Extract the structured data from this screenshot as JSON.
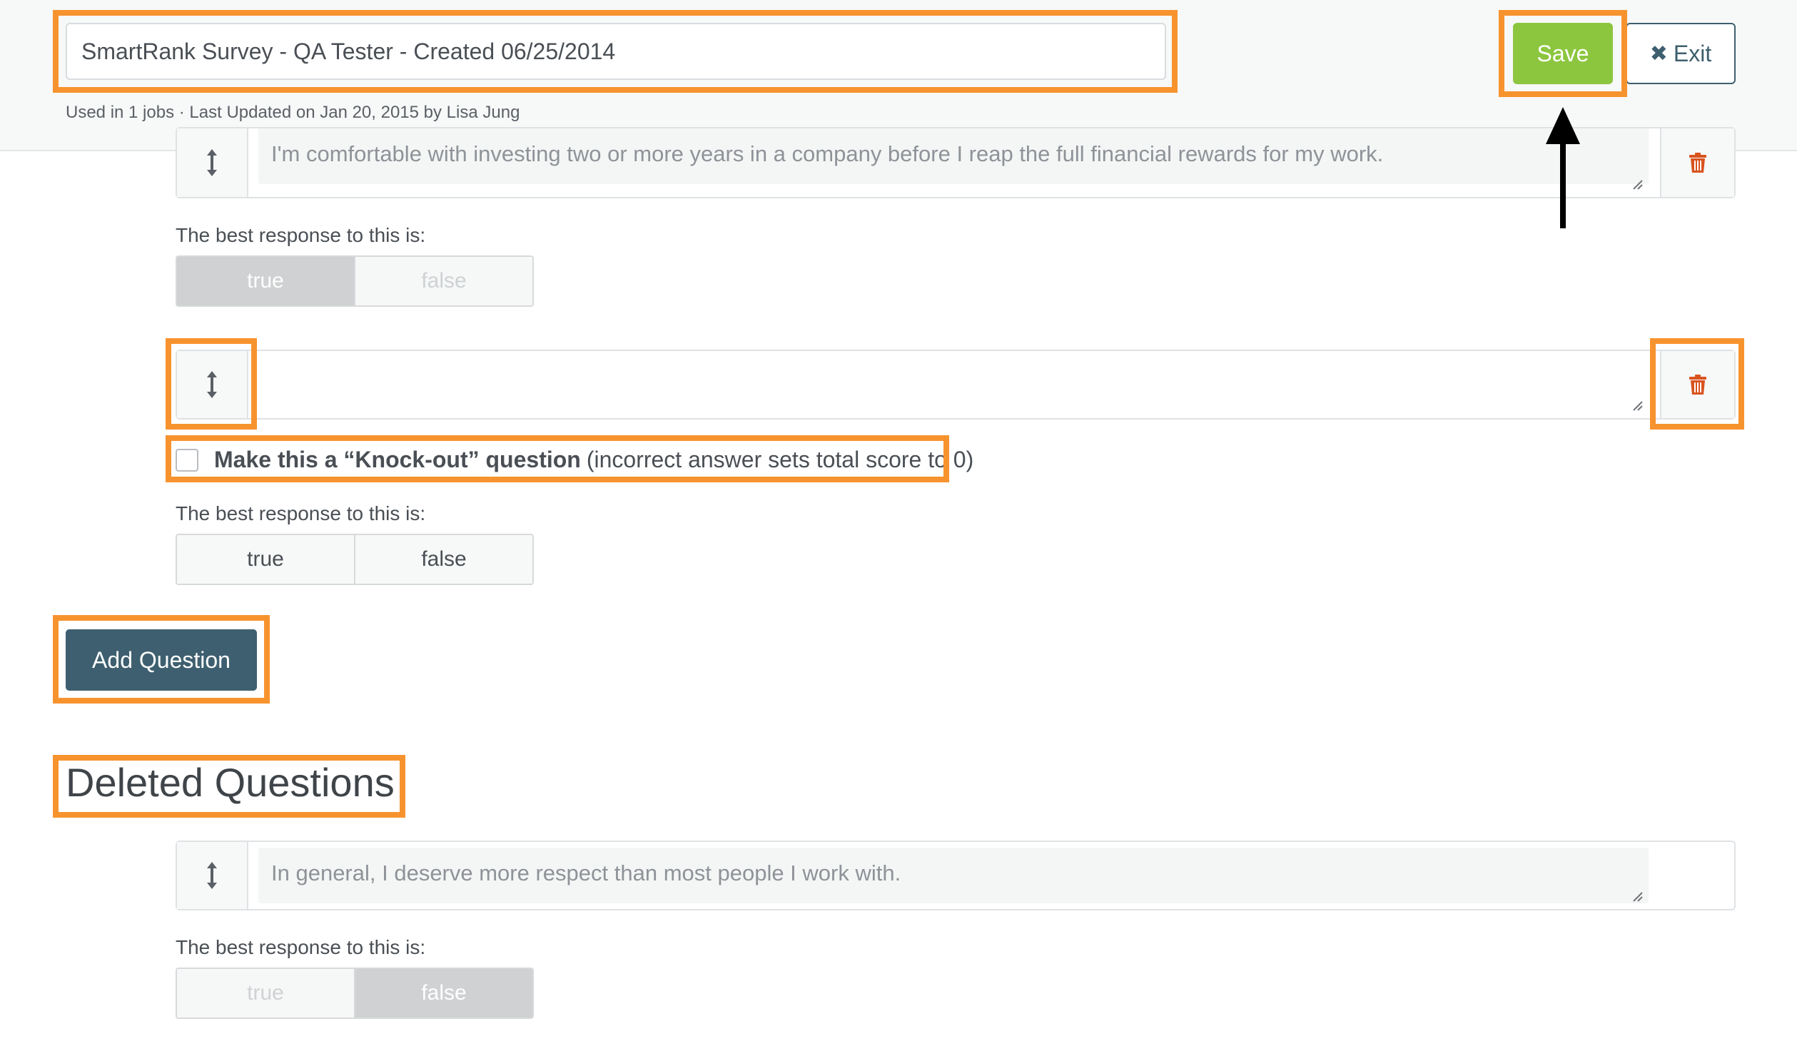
{
  "header": {
    "survey_title": "SmartRank Survey - QA Tester - Created 06/25/2014",
    "meta": "Used in 1 jobs · Last Updated on Jan 20, 2015 by Lisa Jung",
    "save_label": "Save",
    "exit_label": "Exit",
    "colors": {
      "save": "#8cc63f",
      "exit": "#3e5f6f"
    }
  },
  "questions": [
    {
      "text": "I'm comfortable with investing two or more years in a company before I reap the full financial rewards for my work.",
      "best_label": "The best response to this is:",
      "options": [
        "true",
        "false"
      ],
      "selected": "true"
    },
    {
      "text": "",
      "knockout_bold": "Make this a “Knock-out” question",
      "knockout_rest": "(incorrect answer sets total score to 0)",
      "knockout_checked": false,
      "best_label": "The best response to this is:",
      "options": [
        "true",
        "false"
      ],
      "selected": null
    }
  ],
  "add_question_label": "Add Question",
  "deleted": {
    "title": "Deleted Questions",
    "questions": [
      {
        "text": "In general, I deserve more respect than most people I work with.",
        "best_label": "The best response to this is:",
        "options": [
          "true",
          "false"
        ],
        "selected": "false"
      }
    ]
  },
  "icons": {
    "drag": "vertical-resize-icon",
    "delete": "trash-icon",
    "exit": "close-icon"
  },
  "annotation_color": "#f7932e"
}
